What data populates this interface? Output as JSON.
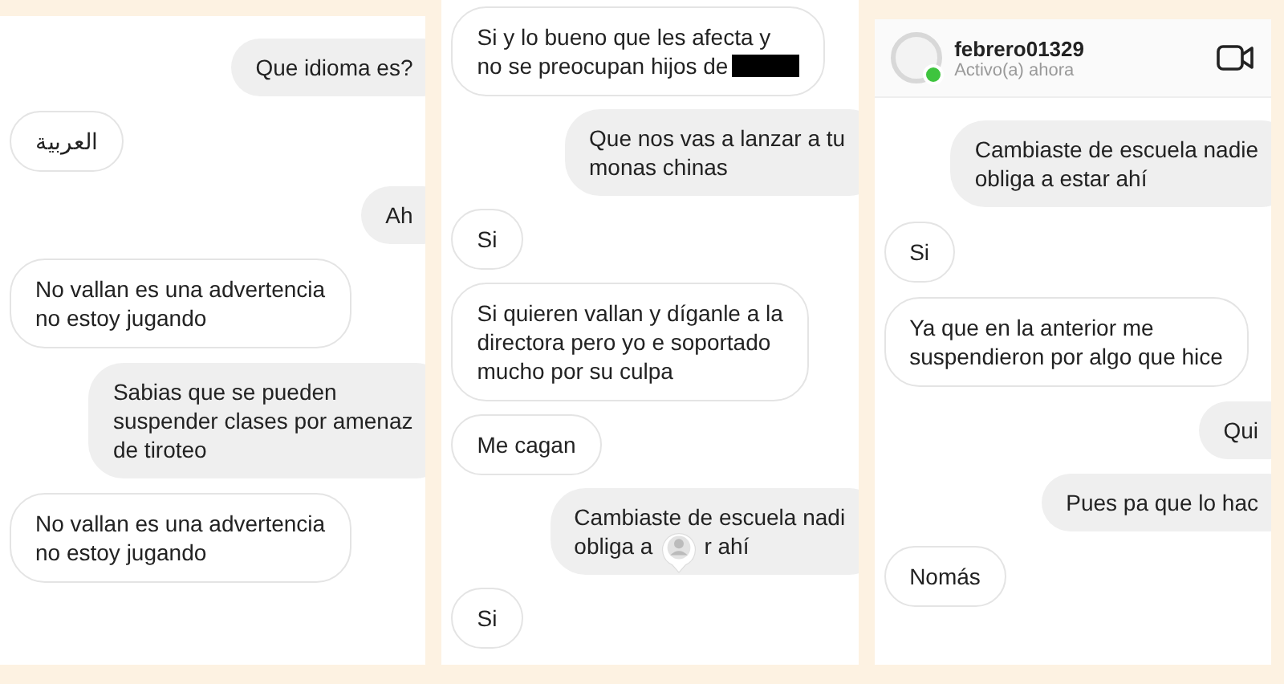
{
  "panels": [
    {
      "messages": [
        {
          "kind": "sent",
          "text": "Que idioma es?"
        },
        {
          "kind": "received",
          "text": "العربية"
        },
        {
          "kind": "sent",
          "text": "Ah"
        },
        {
          "kind": "received",
          "text": "No vallan es una advertencia\nno estoy jugando"
        },
        {
          "kind": "sent",
          "text": "Sabias que se pueden\nsuspender clases por amenaz\nde tiroteo"
        },
        {
          "kind": "received",
          "text": "No vallan es una advertencia\nno estoy jugando"
        }
      ]
    },
    {
      "messages": [
        {
          "kind": "received",
          "text": "Si y lo bueno que les afecta y\nno se preocupan hijos de",
          "redacted": true
        },
        {
          "kind": "sent",
          "text": "Que nos vas a lanzar a tu\nmonas chinas"
        },
        {
          "kind": "received",
          "text": "Si"
        },
        {
          "kind": "received",
          "text": "Si quieren vallan y díganle a la\ndirectora pero yo e soportado\nmucho por su culpa"
        },
        {
          "kind": "received",
          "text": "Me cagan"
        },
        {
          "kind": "sent",
          "text": "Cambiaste de escuela nadi\nobliga a",
          "after_pin": "r ahí"
        },
        {
          "kind": "received",
          "text": "Si"
        }
      ]
    },
    {
      "header": {
        "name": "febrero01329",
        "status": "Activo(a) ahora",
        "online": true
      },
      "messages": [
        {
          "kind": "sent",
          "text": "Cambiaste de escuela nadie\nobliga a estar ahí"
        },
        {
          "kind": "received",
          "text": "Si"
        },
        {
          "kind": "received",
          "text": "Ya que en la anterior me\nsuspendieron por algo que hice"
        },
        {
          "kind": "sent",
          "text": "Qui"
        },
        {
          "kind": "sent",
          "text": "Pues pa que lo hac"
        },
        {
          "kind": "received",
          "text": "Nomás"
        }
      ]
    }
  ]
}
